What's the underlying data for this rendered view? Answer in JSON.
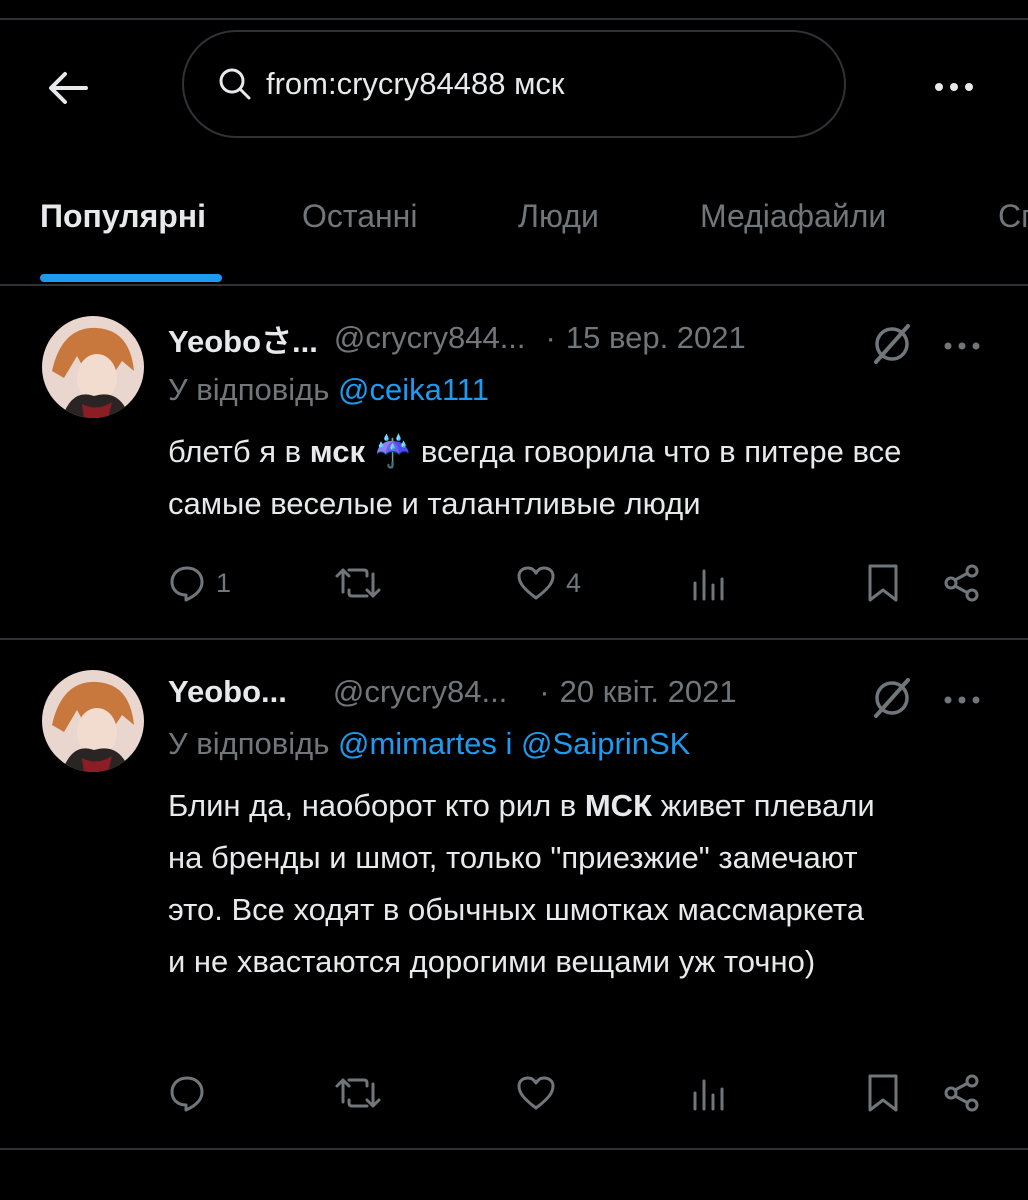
{
  "search": {
    "query": "from:crycry84488 мск"
  },
  "tabs": [
    {
      "label": "Популярні"
    },
    {
      "label": "Останні"
    },
    {
      "label": "Люди"
    },
    {
      "label": "Медіафайли"
    },
    {
      "label": "Сп"
    }
  ],
  "tweets": [
    {
      "name": "Yeoboさ...",
      "handle": "@crycry844...",
      "sep": "·",
      "date": "15 вер. 2021",
      "reply_prefix": "У відповідь",
      "reply_mentions": "@ceika111",
      "body_parts": [
        "блетб я в ",
        "мск",
        " ☔ всегда говорила что в питере все самые веселые и талантливые люди"
      ],
      "replies": "1",
      "reposts": "",
      "likes": "4"
    },
    {
      "name": "Yeobo...",
      "handle": "@crycry84...",
      "sep": "·",
      "date": "20 квіт. 2021",
      "reply_prefix": "У відповідь",
      "reply_mentions": "@mimartes і @SaiprinSK",
      "body_parts": [
        "Блин да, наоборот кто рил в ",
        "МСК",
        " живет плевали на бренды и шмот, только \"приезжие\" замечают это. Все ходят в обычных шмотках массмаркета и не хвастаются дорогими вещами уж точно)"
      ],
      "replies": "",
      "reposts": "",
      "likes": ""
    }
  ],
  "colors": {
    "accent": "#1d9bf0",
    "muted": "#71767b",
    "text": "#e7e9ea",
    "divider": "#2f3336"
  }
}
